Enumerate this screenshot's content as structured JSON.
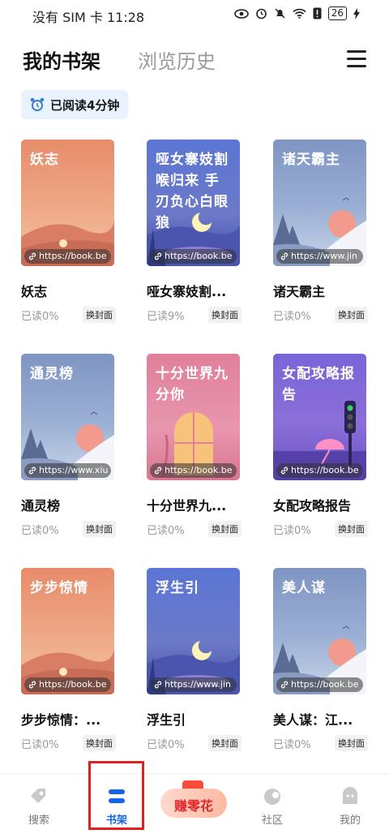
{
  "status_bar": {
    "carrier": "没有 SIM 卡",
    "time": "11:28",
    "battery": "26"
  },
  "header": {
    "tab_shelf": "我的书架",
    "tab_history": "浏览历史"
  },
  "reading_badge": "已阅读4分钟",
  "books": [
    {
      "cover_title": "妖志",
      "name": "妖志",
      "url": "https://book.be",
      "progress": "已读0%",
      "swap": "换封面",
      "theme": "desert"
    },
    {
      "cover_title": "哑女寨妓割喉归来 手刃负心白眼狼",
      "name": "哑女寨妓割...",
      "url": "https://book.be",
      "progress": "已读9%",
      "swap": "换封面",
      "theme": "moon"
    },
    {
      "cover_title": "诸天霸主",
      "name": "诸天霸主",
      "url": "https://www.jin",
      "progress": "已读0%",
      "swap": "换封面",
      "theme": "mountain"
    },
    {
      "cover_title": "通灵榜",
      "name": "通灵榜",
      "url": "https://www.xiu",
      "progress": "已读0%",
      "swap": "换封面",
      "theme": "mountain"
    },
    {
      "cover_title": "十分世界九分你",
      "name": "十分世界九...",
      "url": "https://book.be",
      "progress": "已读0%",
      "swap": "换封面",
      "theme": "window"
    },
    {
      "cover_title": "女配攻略报告",
      "name": "女配攻略报告",
      "url": "https://book.be",
      "progress": "已读0%",
      "swap": "换封面",
      "theme": "purple"
    },
    {
      "cover_title": "步步惊情",
      "name": "步步惊情：...",
      "url": "https://book.be",
      "progress": "已读0%",
      "swap": "换封面",
      "theme": "desert"
    },
    {
      "cover_title": "浮生引",
      "name": "浮生引",
      "url": "https://www.jin",
      "progress": "已读0%",
      "swap": "换封面",
      "theme": "moon"
    },
    {
      "cover_title": "美人谋",
      "name": "美人谋：江...",
      "url": "https://book.be",
      "progress": "已读0%",
      "swap": "换封面",
      "theme": "mountain"
    }
  ],
  "bottom_nav": {
    "search": "搜索",
    "shelf": "书架",
    "earn": "赚零花",
    "community": "社区",
    "mine": "我的"
  },
  "colors": {
    "accent": "#1565e8",
    "highlight": "#e02020"
  }
}
